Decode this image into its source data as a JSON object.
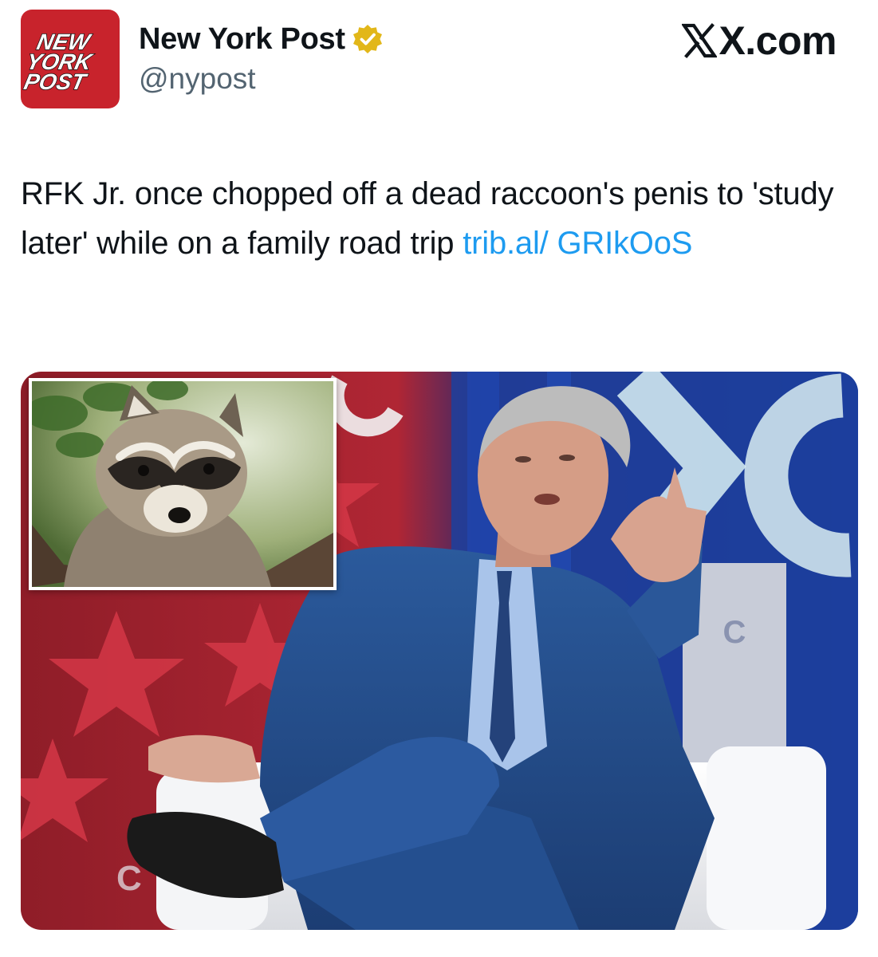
{
  "account": {
    "display_name": "New York Post",
    "handle": "@nypost",
    "avatar_logo_lines": [
      "NEW",
      "YORK",
      "POST"
    ],
    "verified": true,
    "avatar_color": "#c8232c",
    "badge_color": "#e2b719"
  },
  "brand": {
    "label": "X.com"
  },
  "post": {
    "text": "RFK Jr. once chopped off a dead raccoon's penis to 'study later' while on a family road trip",
    "link_label": "trib.al/ GRIkOoS",
    "link_color": "#1d9bf0"
  },
  "media": {
    "main_image": "man-in-blue-suit-seated-on-white-chair-at-conference-stage",
    "inset_image": "raccoon-in-tree",
    "backdrop_text": [
      "C",
      "C"
    ]
  },
  "icons": {
    "verified": "verified-badge-icon",
    "brand": "x-logo-icon"
  }
}
